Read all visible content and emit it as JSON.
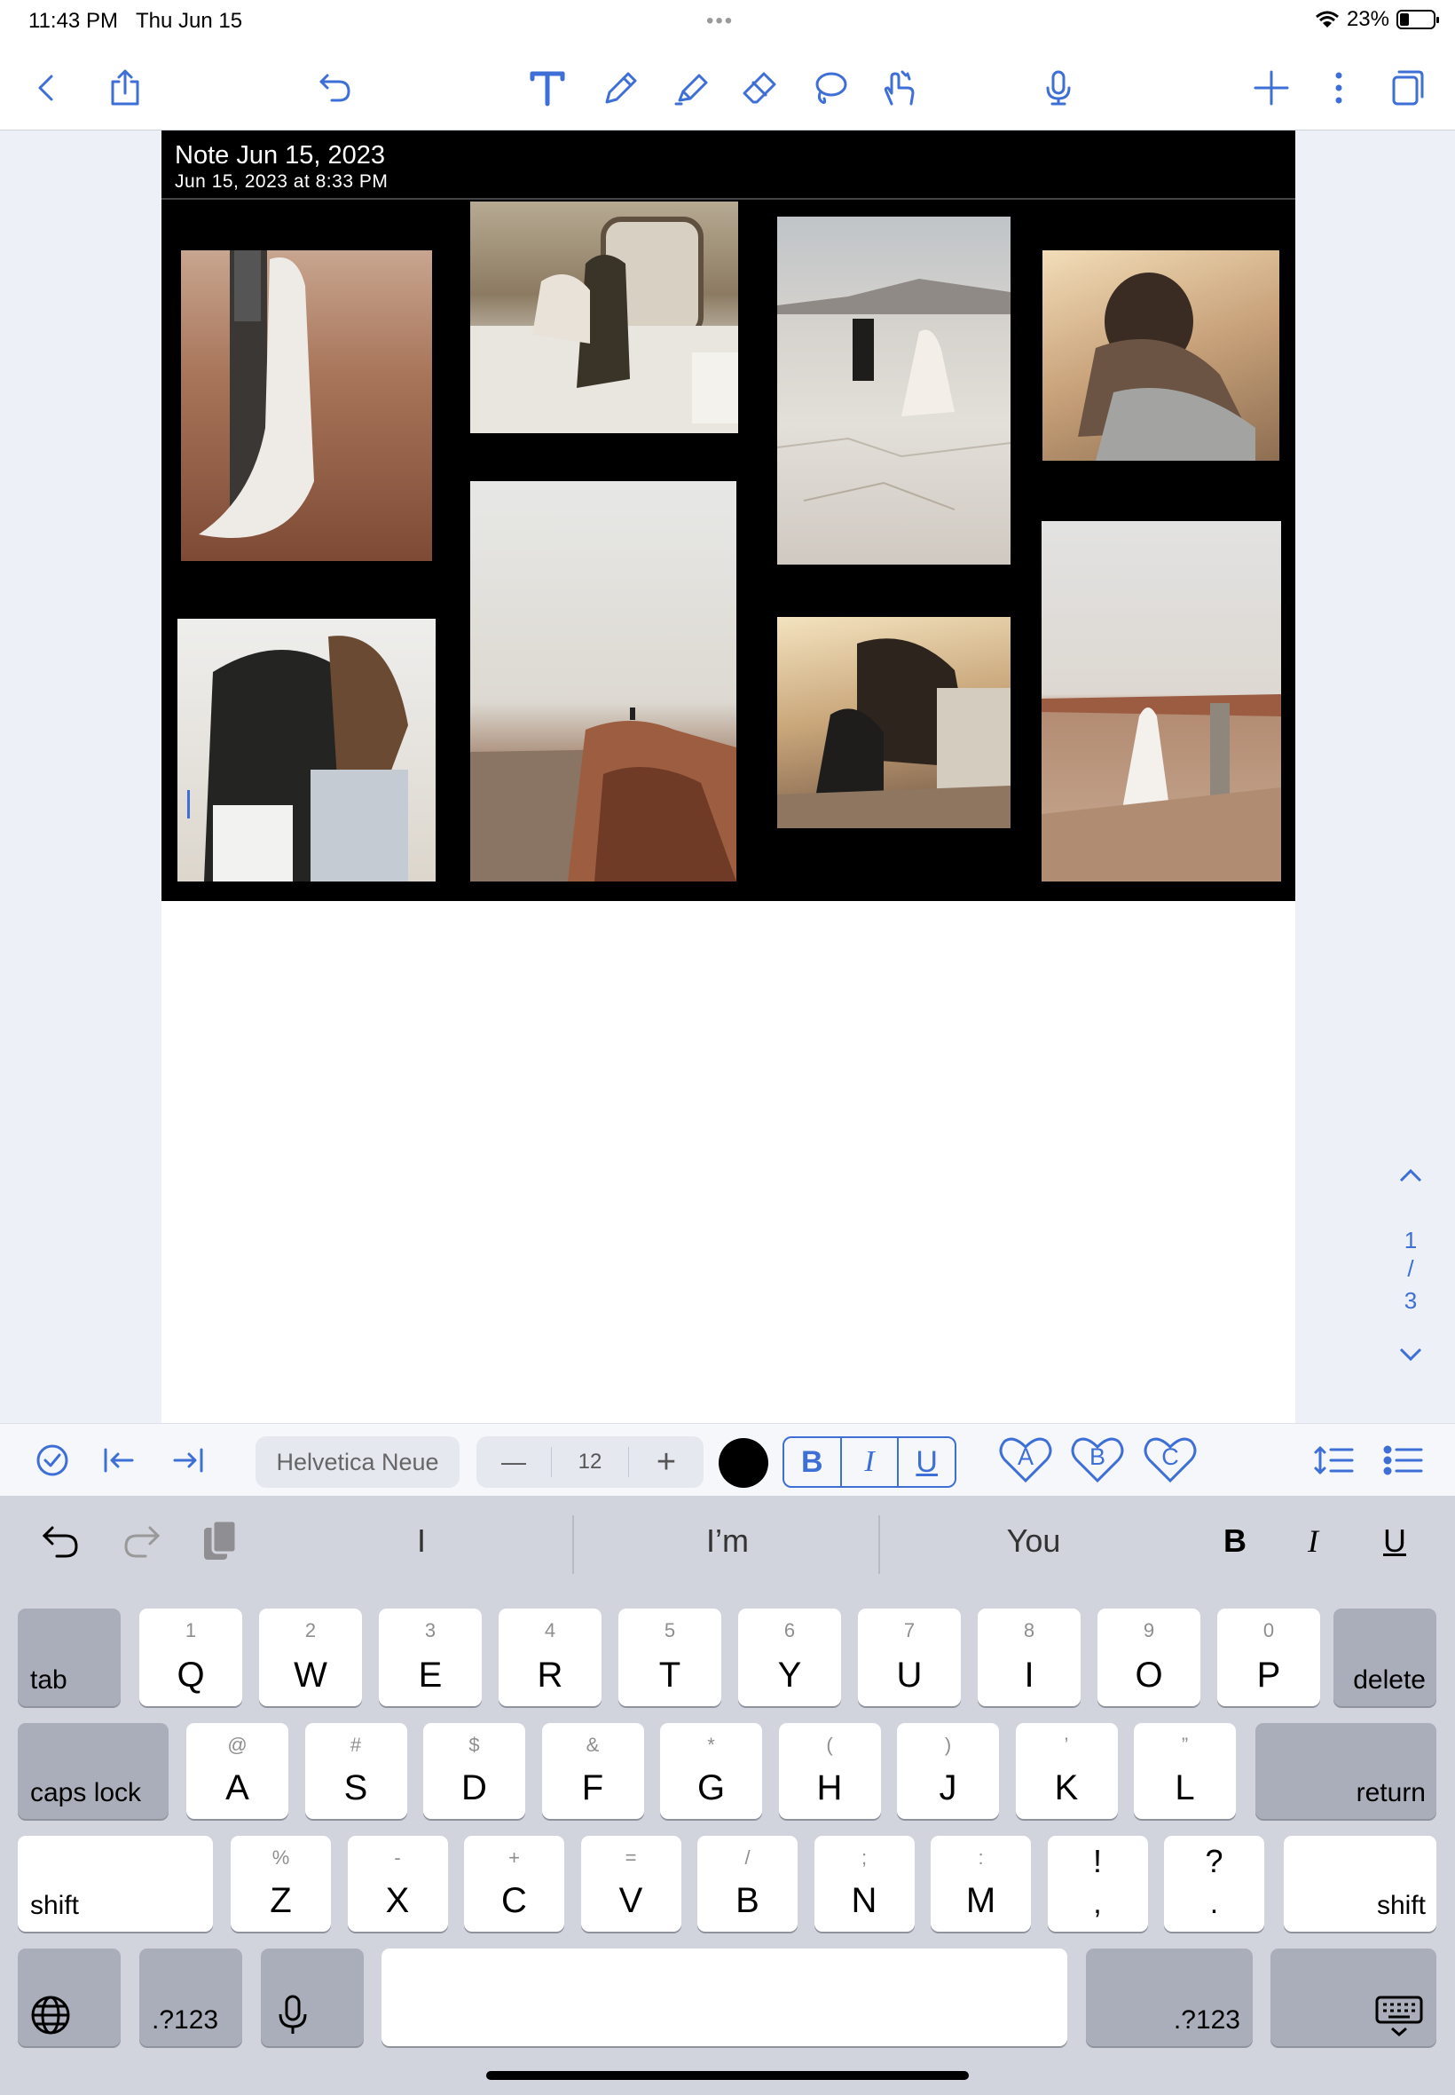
{
  "status_bar": {
    "time": "11:43 PM",
    "date": "Thu Jun 15",
    "battery": "23%"
  },
  "toolbar": {
    "icons": [
      "back-icon",
      "share-icon",
      "undo-icon",
      "text-tool-icon",
      "pen-icon",
      "highlighter-icon",
      "eraser-icon",
      "lasso-icon",
      "hand-tool-icon",
      "microphone-icon",
      "add-icon",
      "more-icon",
      "pages-icon"
    ]
  },
  "note": {
    "title": "Note Jun 15, 2023",
    "date": "Jun 15, 2023 at 8:33 PM"
  },
  "pager": {
    "current": "1",
    "separator": "/",
    "total": "3"
  },
  "format_bar": {
    "font_name": "Helvetica Neue",
    "minus": "—",
    "font_size": "12",
    "plus": "+",
    "bold": "B",
    "italic": "I",
    "underline": "U",
    "styles": [
      "A",
      "B",
      "C"
    ],
    "text_color": "#000000"
  },
  "keyboard": {
    "suggestions": [
      "I",
      "I’m",
      "You"
    ],
    "format": {
      "bold": "B",
      "italic": "I",
      "underline": "U"
    },
    "row1": [
      {
        "p": "Q",
        "s": "1"
      },
      {
        "p": "W",
        "s": "2"
      },
      {
        "p": "E",
        "s": "3"
      },
      {
        "p": "R",
        "s": "4"
      },
      {
        "p": "T",
        "s": "5"
      },
      {
        "p": "Y",
        "s": "6"
      },
      {
        "p": "U",
        "s": "7"
      },
      {
        "p": "I",
        "s": "8"
      },
      {
        "p": "O",
        "s": "9"
      },
      {
        "p": "P",
        "s": "0"
      }
    ],
    "row2": [
      {
        "p": "A",
        "s": "@"
      },
      {
        "p": "S",
        "s": "#"
      },
      {
        "p": "D",
        "s": "$"
      },
      {
        "p": "F",
        "s": "&"
      },
      {
        "p": "G",
        "s": "*"
      },
      {
        "p": "H",
        "s": "("
      },
      {
        "p": "J",
        "s": ")"
      },
      {
        "p": "K",
        "s": "’"
      },
      {
        "p": "L",
        "s": "”"
      }
    ],
    "row3": [
      {
        "p": "Z",
        "s": "%"
      },
      {
        "p": "X",
        "s": "-"
      },
      {
        "p": "C",
        "s": "+"
      },
      {
        "p": "V",
        "s": "="
      },
      {
        "p": "B",
        "s": "/"
      },
      {
        "p": "N",
        "s": ";"
      },
      {
        "p": "M",
        "s": ":"
      },
      {
        "p": ",",
        "s": "!"
      },
      {
        "p": ".",
        "s": "?"
      }
    ],
    "tab": "tab",
    "delete": "delete",
    "caps_lock": "caps lock",
    "return": "return",
    "shift": "shift",
    "numbers": ".?123"
  }
}
